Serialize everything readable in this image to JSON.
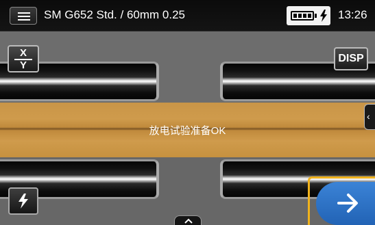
{
  "status_bar": {
    "title": "SM G652 Std. / 60mm 0.25",
    "time": "13:26",
    "battery_icon": "battery-charging-icon"
  },
  "image_view": {
    "status_message": "放电试验准备OK",
    "band_color": "#c99547"
  },
  "buttons": {
    "xy_top": "X",
    "xy_bottom": "Y",
    "disp": "DISP",
    "menu_icon": "hamburger-menu-icon",
    "arc_icon": "lightning-bolt-icon",
    "next_icon": "arrow-right-icon",
    "side_tab_icon": "chevron-left-icon",
    "bottom_tab_icon": "chevron-up-icon"
  },
  "colors": {
    "accent_blue": "#2a6fc4",
    "highlight_yellow": "#f0b21c"
  }
}
